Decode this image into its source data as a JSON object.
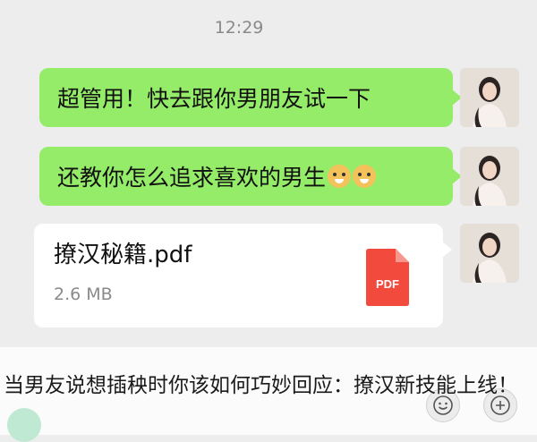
{
  "chat": {
    "timestamp": "12:29",
    "messages": [
      {
        "type": "text",
        "text": "超管用！快去跟你男朋友试一下"
      },
      {
        "type": "text",
        "text": "还教你怎么追求喜欢的男生",
        "emojis": [
          "doge-emoji",
          "doge-emoji"
        ]
      },
      {
        "type": "file",
        "file_name": "撩汉秘籍.pdf",
        "file_size": "2.6 MB",
        "file_icon_label": "PDF"
      }
    ]
  },
  "caption": {
    "text": "当男友说想插秧时你该如何巧妙回应：撩汉新技能上线！"
  },
  "colors": {
    "background": "#ededed",
    "bubble": "#95ec69",
    "pdf_red": "#f24a3c"
  }
}
